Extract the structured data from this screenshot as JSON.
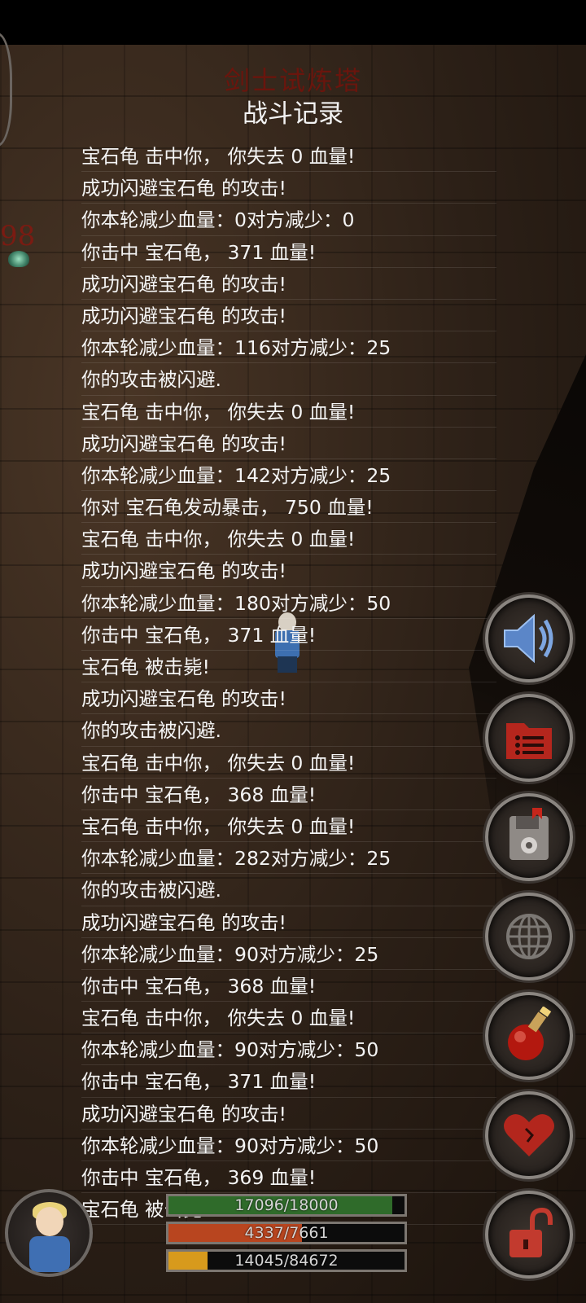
{
  "header": {
    "tower_title": "剑士试炼塔",
    "log_title": "战斗记录"
  },
  "enemy": {
    "level_fragment": "98",
    "icon": "turtle-icon"
  },
  "log": {
    "lines": [
      "宝石龟 击中你， 你失去 0 血量!",
      "成功闪避宝石龟 的攻击!",
      "你本轮减少血量：0对方减少：0",
      "你击中 宝石龟， 371 血量!",
      "成功闪避宝石龟 的攻击!",
      "成功闪避宝石龟 的攻击!",
      "你本轮减少血量：116对方减少：25",
      "你的攻击被闪避.",
      "宝石龟 击中你， 你失去 0 血量!",
      "成功闪避宝石龟 的攻击!",
      "你本轮减少血量：142对方减少：25",
      "你对 宝石龟发动暴击， 750 血量!",
      "宝石龟 击中你， 你失去 0 血量!",
      "成功闪避宝石龟 的攻击!",
      "你本轮减少血量：180对方减少：50",
      "你击中 宝石龟， 371 血量!",
      "宝石龟 被击毙!",
      "成功闪避宝石龟 的攻击!",
      "你的攻击被闪避.",
      "宝石龟 击中你， 你失去 0 血量!",
      "你击中 宝石龟， 368 血量!",
      "宝石龟 击中你， 你失去 0 血量!",
      "你本轮减少血量：282对方减少：25",
      "你的攻击被闪避.",
      "成功闪避宝石龟 的攻击!",
      "你本轮减少血量：90对方减少：25",
      "你击中 宝石龟， 368 血量!",
      "宝石龟 击中你， 你失去 0 血量!",
      "你本轮减少血量：90对方减少：50",
      "你击中 宝石龟， 371 血量!",
      "成功闪避宝石龟 的攻击!",
      "你本轮减少血量：90对方减少：50",
      "你击中 宝石龟， 369 血量!",
      "宝石龟 被击毙!"
    ],
    "end_marker": "--"
  },
  "side_buttons": [
    {
      "icon": "speaker-icon",
      "name": "sound-button"
    },
    {
      "icon": "menu-list-icon",
      "name": "menu-button"
    },
    {
      "icon": "save-disk-icon",
      "name": "save-button"
    },
    {
      "icon": "globe-icon",
      "name": "world-button"
    },
    {
      "icon": "potion-icon",
      "name": "potion-button"
    },
    {
      "icon": "heart-icon",
      "name": "heal-button"
    },
    {
      "icon": "unlock-icon",
      "name": "lock-button"
    }
  ],
  "status": {
    "hp": {
      "label": "17096/18000",
      "current": 17096,
      "max": 18000,
      "color": "#2f6b2a"
    },
    "mp": {
      "label": "4337/7661",
      "current": 4337,
      "max": 7661,
      "color": "#b8451f"
    },
    "exp": {
      "label": "14045/84672",
      "current": 14045,
      "max": 84672,
      "color": "#d79a1c"
    }
  }
}
